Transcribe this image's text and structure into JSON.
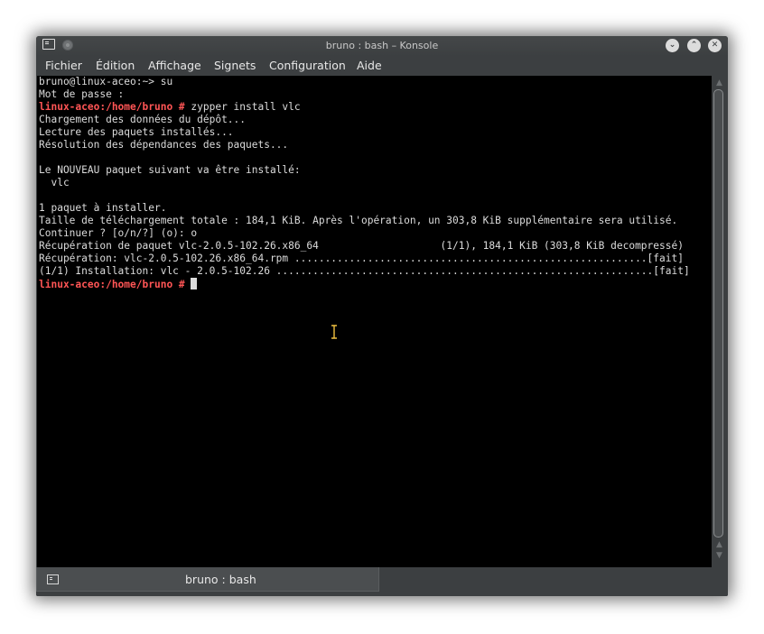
{
  "window": {
    "title": "bruno : bash – Konsole",
    "controls": {
      "minimize_glyph": "⌄",
      "maximize_glyph": "⌃",
      "close_glyph": "✕"
    }
  },
  "menubar": {
    "items": [
      {
        "label": "Fichier"
      },
      {
        "label": "Édition"
      },
      {
        "label": "Affichage"
      },
      {
        "label": "Signets"
      },
      {
        "label": "Configuration"
      },
      {
        "label": "Aide"
      }
    ]
  },
  "terminal": {
    "lines": [
      {
        "prompt": "",
        "text": "bruno@linux-aceo:~> su"
      },
      {
        "prompt": "",
        "text": "Mot de passe :"
      },
      {
        "prompt": "linux-aceo:/home/bruno #",
        "text": " zypper install vlc"
      },
      {
        "prompt": "",
        "text": "Chargement des données du dépôt..."
      },
      {
        "prompt": "",
        "text": "Lecture des paquets installés..."
      },
      {
        "prompt": "",
        "text": "Résolution des dépendances des paquets..."
      },
      {
        "prompt": "",
        "text": ""
      },
      {
        "prompt": "",
        "text": "Le NOUVEAU paquet suivant va être installé:"
      },
      {
        "prompt": "",
        "text": "  vlc"
      },
      {
        "prompt": "",
        "text": ""
      },
      {
        "prompt": "",
        "text": "1 paquet à installer."
      },
      {
        "prompt": "",
        "text": "Taille de téléchargement totale : 184,1 KiB. Après l'opération, un 303,8 KiB supplémentaire sera utilisé."
      },
      {
        "prompt": "",
        "text": "Continuer ? [o/n/?] (o): o"
      },
      {
        "prompt": "",
        "text": "Récupération de paquet vlc-2.0.5-102.26.x86_64                    (1/1), 184,1 KiB (303,8 KiB decompressé)"
      },
      {
        "prompt": "",
        "text": "Récupération: vlc-2.0.5-102.26.x86_64.rpm ..........................................................[fait]"
      },
      {
        "prompt": "",
        "text": "(1/1) Installation: vlc - 2.0.5-102.26 ..............................................................[fait]"
      },
      {
        "prompt": "linux-aceo:/home/bruno #",
        "text": " "
      }
    ]
  },
  "tabs": [
    {
      "label": "bruno : bash",
      "icon": "terminal-icon"
    }
  ],
  "colors": {
    "terminal_bg": "#000000",
    "terminal_fg": "#dcdcdc",
    "prompt": "#ff5555",
    "chrome": "#3c3f41",
    "ibeam_cursor": "#f0c040"
  }
}
